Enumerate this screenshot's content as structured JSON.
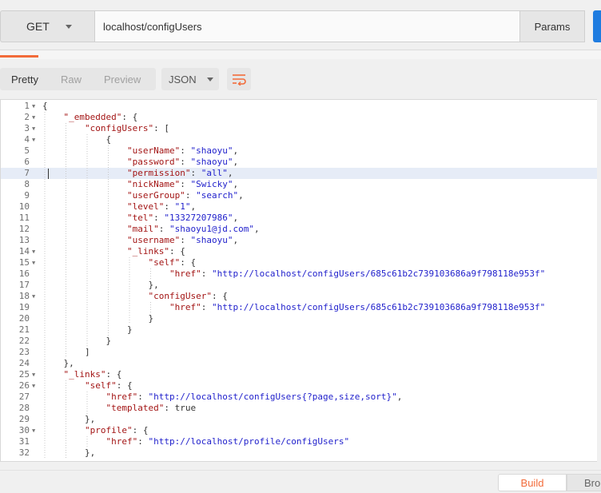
{
  "request": {
    "method": "GET",
    "url": "localhost/configUsers",
    "params_label": "Params"
  },
  "response": {
    "view_tabs": [
      {
        "label": "Pretty",
        "active": true
      },
      {
        "label": "Raw",
        "active": false
      },
      {
        "label": "Preview",
        "active": false
      }
    ],
    "format": "JSON"
  },
  "colors": {
    "accent": "#f26b3a",
    "send": "#1f7ce0",
    "json_key": "#a31515",
    "json_string": "#2222cc",
    "highlight": "#e6ecf7"
  },
  "icons": {
    "wrap": "wrap-lines-icon",
    "caret": "chevron-down-icon",
    "fold": "fold-arrow-icon"
  },
  "editor": {
    "highlighted_line": 7,
    "lines": [
      {
        "n": "1",
        "fold": true,
        "indent": 0,
        "tokens": [
          [
            "p",
            "{"
          ]
        ]
      },
      {
        "n": "2",
        "fold": true,
        "indent": 1,
        "tokens": [
          [
            "k",
            "\"_embedded\""
          ],
          [
            "p",
            ": {"
          ]
        ]
      },
      {
        "n": "3",
        "fold": true,
        "indent": 2,
        "tokens": [
          [
            "k",
            "\"configUsers\""
          ],
          [
            "p",
            ": ["
          ]
        ]
      },
      {
        "n": "4",
        "fold": true,
        "indent": 3,
        "tokens": [
          [
            "p",
            "{"
          ]
        ]
      },
      {
        "n": "5",
        "fold": false,
        "indent": 4,
        "tokens": [
          [
            "k",
            "\"userName\""
          ],
          [
            "p",
            ": "
          ],
          [
            "s",
            "\"shaoyu\""
          ],
          [
            "p",
            ","
          ]
        ]
      },
      {
        "n": "6",
        "fold": false,
        "indent": 4,
        "tokens": [
          [
            "k",
            "\"password\""
          ],
          [
            "p",
            ": "
          ],
          [
            "s",
            "\"shaoyu\""
          ],
          [
            "p",
            ","
          ]
        ]
      },
      {
        "n": "7",
        "fold": false,
        "indent": 4,
        "tokens": [
          [
            "k",
            "\"permission\""
          ],
          [
            "p",
            ": "
          ],
          [
            "s",
            "\"all\""
          ],
          [
            "p",
            ","
          ]
        ]
      },
      {
        "n": "8",
        "fold": false,
        "indent": 4,
        "tokens": [
          [
            "k",
            "\"nickName\""
          ],
          [
            "p",
            ": "
          ],
          [
            "s",
            "\"Swicky\""
          ],
          [
            "p",
            ","
          ]
        ]
      },
      {
        "n": "9",
        "fold": false,
        "indent": 4,
        "tokens": [
          [
            "k",
            "\"userGroup\""
          ],
          [
            "p",
            ": "
          ],
          [
            "s",
            "\"search\""
          ],
          [
            "p",
            ","
          ]
        ]
      },
      {
        "n": "10",
        "fold": false,
        "indent": 4,
        "tokens": [
          [
            "k",
            "\"level\""
          ],
          [
            "p",
            ": "
          ],
          [
            "s",
            "\"1\""
          ],
          [
            "p",
            ","
          ]
        ]
      },
      {
        "n": "11",
        "fold": false,
        "indent": 4,
        "tokens": [
          [
            "k",
            "\"tel\""
          ],
          [
            "p",
            ": "
          ],
          [
            "s",
            "\"13327207986\""
          ],
          [
            "p",
            ","
          ]
        ]
      },
      {
        "n": "12",
        "fold": false,
        "indent": 4,
        "tokens": [
          [
            "k",
            "\"mail\""
          ],
          [
            "p",
            ": "
          ],
          [
            "s",
            "\"shaoyu1@jd.com\""
          ],
          [
            "p",
            ","
          ]
        ]
      },
      {
        "n": "13",
        "fold": false,
        "indent": 4,
        "tokens": [
          [
            "k",
            "\"username\""
          ],
          [
            "p",
            ": "
          ],
          [
            "s",
            "\"shaoyu\""
          ],
          [
            "p",
            ","
          ]
        ]
      },
      {
        "n": "14",
        "fold": true,
        "indent": 4,
        "tokens": [
          [
            "k",
            "\"_links\""
          ],
          [
            "p",
            ": {"
          ]
        ]
      },
      {
        "n": "15",
        "fold": true,
        "indent": 5,
        "tokens": [
          [
            "k",
            "\"self\""
          ],
          [
            "p",
            ": {"
          ]
        ]
      },
      {
        "n": "16",
        "fold": false,
        "indent": 6,
        "tokens": [
          [
            "k",
            "\"href\""
          ],
          [
            "p",
            ": "
          ],
          [
            "s",
            "\"http://localhost/configUsers/685c61b2c739103686a9f798118e953f\""
          ]
        ]
      },
      {
        "n": "17",
        "fold": false,
        "indent": 5,
        "tokens": [
          [
            "p",
            "},"
          ]
        ]
      },
      {
        "n": "18",
        "fold": true,
        "indent": 5,
        "tokens": [
          [
            "k",
            "\"configUser\""
          ],
          [
            "p",
            ": {"
          ]
        ]
      },
      {
        "n": "19",
        "fold": false,
        "indent": 6,
        "tokens": [
          [
            "k",
            "\"href\""
          ],
          [
            "p",
            ": "
          ],
          [
            "s",
            "\"http://localhost/configUsers/685c61b2c739103686a9f798118e953f\""
          ]
        ]
      },
      {
        "n": "20",
        "fold": false,
        "indent": 5,
        "tokens": [
          [
            "p",
            "}"
          ]
        ]
      },
      {
        "n": "21",
        "fold": false,
        "indent": 4,
        "tokens": [
          [
            "p",
            "}"
          ]
        ]
      },
      {
        "n": "22",
        "fold": false,
        "indent": 3,
        "tokens": [
          [
            "p",
            "}"
          ]
        ]
      },
      {
        "n": "23",
        "fold": false,
        "indent": 2,
        "tokens": [
          [
            "p",
            "]"
          ]
        ]
      },
      {
        "n": "24",
        "fold": false,
        "indent": 1,
        "tokens": [
          [
            "p",
            "},"
          ]
        ]
      },
      {
        "n": "25",
        "fold": true,
        "indent": 1,
        "tokens": [
          [
            "k",
            "\"_links\""
          ],
          [
            "p",
            ": {"
          ]
        ]
      },
      {
        "n": "26",
        "fold": true,
        "indent": 2,
        "tokens": [
          [
            "k",
            "\"self\""
          ],
          [
            "p",
            ": {"
          ]
        ]
      },
      {
        "n": "27",
        "fold": false,
        "indent": 3,
        "tokens": [
          [
            "k",
            "\"href\""
          ],
          [
            "p",
            ": "
          ],
          [
            "s",
            "\"http://localhost/configUsers{?page,size,sort}\""
          ],
          [
            "p",
            ","
          ]
        ]
      },
      {
        "n": "28",
        "fold": false,
        "indent": 3,
        "tokens": [
          [
            "k",
            "\"templated\""
          ],
          [
            "p",
            ": true"
          ]
        ]
      },
      {
        "n": "29",
        "fold": false,
        "indent": 2,
        "tokens": [
          [
            "p",
            "},"
          ]
        ]
      },
      {
        "n": "30",
        "fold": true,
        "indent": 2,
        "tokens": [
          [
            "k",
            "\"profile\""
          ],
          [
            "p",
            ": {"
          ]
        ]
      },
      {
        "n": "31",
        "fold": false,
        "indent": 3,
        "tokens": [
          [
            "k",
            "\"href\""
          ],
          [
            "p",
            ": "
          ],
          [
            "s",
            "\"http://localhost/profile/configUsers\""
          ]
        ]
      },
      {
        "n": "32",
        "fold": false,
        "indent": 2,
        "tokens": [
          [
            "p",
            "},"
          ]
        ]
      }
    ]
  },
  "footer": {
    "build_label": "Build",
    "browse_label": "Bro"
  }
}
